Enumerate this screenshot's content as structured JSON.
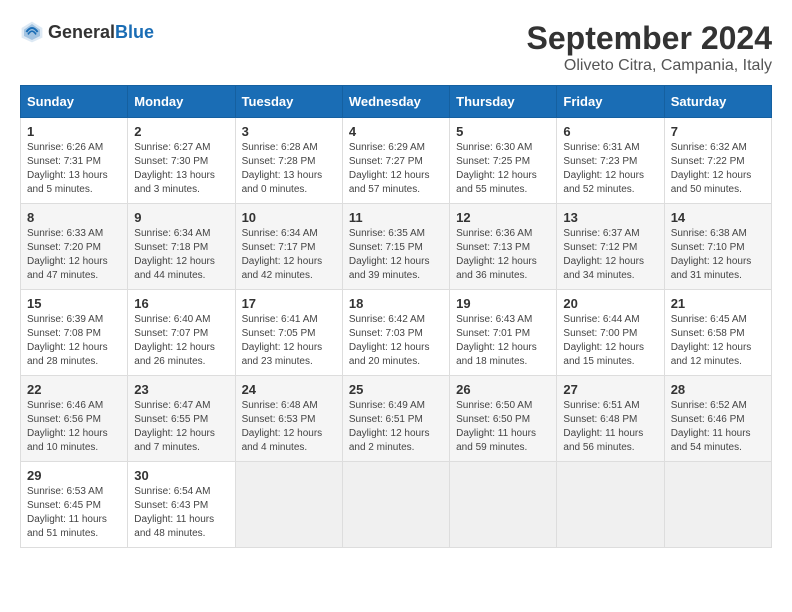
{
  "header": {
    "logo_general": "General",
    "logo_blue": "Blue",
    "title": "September 2024",
    "location": "Oliveto Citra, Campania, Italy"
  },
  "calendar": {
    "days_of_week": [
      "Sunday",
      "Monday",
      "Tuesday",
      "Wednesday",
      "Thursday",
      "Friday",
      "Saturday"
    ],
    "weeks": [
      [
        {
          "day": "1",
          "sunrise": "6:26 AM",
          "sunset": "7:31 PM",
          "daylight": "13 hours and 5 minutes."
        },
        {
          "day": "2",
          "sunrise": "6:27 AM",
          "sunset": "7:30 PM",
          "daylight": "13 hours and 3 minutes."
        },
        {
          "day": "3",
          "sunrise": "6:28 AM",
          "sunset": "7:28 PM",
          "daylight": "13 hours and 0 minutes."
        },
        {
          "day": "4",
          "sunrise": "6:29 AM",
          "sunset": "7:27 PM",
          "daylight": "12 hours and 57 minutes."
        },
        {
          "day": "5",
          "sunrise": "6:30 AM",
          "sunset": "7:25 PM",
          "daylight": "12 hours and 55 minutes."
        },
        {
          "day": "6",
          "sunrise": "6:31 AM",
          "sunset": "7:23 PM",
          "daylight": "12 hours and 52 minutes."
        },
        {
          "day": "7",
          "sunrise": "6:32 AM",
          "sunset": "7:22 PM",
          "daylight": "12 hours and 50 minutes."
        }
      ],
      [
        {
          "day": "8",
          "sunrise": "6:33 AM",
          "sunset": "7:20 PM",
          "daylight": "12 hours and 47 minutes."
        },
        {
          "day": "9",
          "sunrise": "6:34 AM",
          "sunset": "7:18 PM",
          "daylight": "12 hours and 44 minutes."
        },
        {
          "day": "10",
          "sunrise": "6:34 AM",
          "sunset": "7:17 PM",
          "daylight": "12 hours and 42 minutes."
        },
        {
          "day": "11",
          "sunrise": "6:35 AM",
          "sunset": "7:15 PM",
          "daylight": "12 hours and 39 minutes."
        },
        {
          "day": "12",
          "sunrise": "6:36 AM",
          "sunset": "7:13 PM",
          "daylight": "12 hours and 36 minutes."
        },
        {
          "day": "13",
          "sunrise": "6:37 AM",
          "sunset": "7:12 PM",
          "daylight": "12 hours and 34 minutes."
        },
        {
          "day": "14",
          "sunrise": "6:38 AM",
          "sunset": "7:10 PM",
          "daylight": "12 hours and 31 minutes."
        }
      ],
      [
        {
          "day": "15",
          "sunrise": "6:39 AM",
          "sunset": "7:08 PM",
          "daylight": "12 hours and 28 minutes."
        },
        {
          "day": "16",
          "sunrise": "6:40 AM",
          "sunset": "7:07 PM",
          "daylight": "12 hours and 26 minutes."
        },
        {
          "day": "17",
          "sunrise": "6:41 AM",
          "sunset": "7:05 PM",
          "daylight": "12 hours and 23 minutes."
        },
        {
          "day": "18",
          "sunrise": "6:42 AM",
          "sunset": "7:03 PM",
          "daylight": "12 hours and 20 minutes."
        },
        {
          "day": "19",
          "sunrise": "6:43 AM",
          "sunset": "7:01 PM",
          "daylight": "12 hours and 18 minutes."
        },
        {
          "day": "20",
          "sunrise": "6:44 AM",
          "sunset": "7:00 PM",
          "daylight": "12 hours and 15 minutes."
        },
        {
          "day": "21",
          "sunrise": "6:45 AM",
          "sunset": "6:58 PM",
          "daylight": "12 hours and 12 minutes."
        }
      ],
      [
        {
          "day": "22",
          "sunrise": "6:46 AM",
          "sunset": "6:56 PM",
          "daylight": "12 hours and 10 minutes."
        },
        {
          "day": "23",
          "sunrise": "6:47 AM",
          "sunset": "6:55 PM",
          "daylight": "12 hours and 7 minutes."
        },
        {
          "day": "24",
          "sunrise": "6:48 AM",
          "sunset": "6:53 PM",
          "daylight": "12 hours and 4 minutes."
        },
        {
          "day": "25",
          "sunrise": "6:49 AM",
          "sunset": "6:51 PM",
          "daylight": "12 hours and 2 minutes."
        },
        {
          "day": "26",
          "sunrise": "6:50 AM",
          "sunset": "6:50 PM",
          "daylight": "11 hours and 59 minutes."
        },
        {
          "day": "27",
          "sunrise": "6:51 AM",
          "sunset": "6:48 PM",
          "daylight": "11 hours and 56 minutes."
        },
        {
          "day": "28",
          "sunrise": "6:52 AM",
          "sunset": "6:46 PM",
          "daylight": "11 hours and 54 minutes."
        }
      ],
      [
        {
          "day": "29",
          "sunrise": "6:53 AM",
          "sunset": "6:45 PM",
          "daylight": "11 hours and 51 minutes."
        },
        {
          "day": "30",
          "sunrise": "6:54 AM",
          "sunset": "6:43 PM",
          "daylight": "11 hours and 48 minutes."
        },
        null,
        null,
        null,
        null,
        null
      ]
    ]
  }
}
